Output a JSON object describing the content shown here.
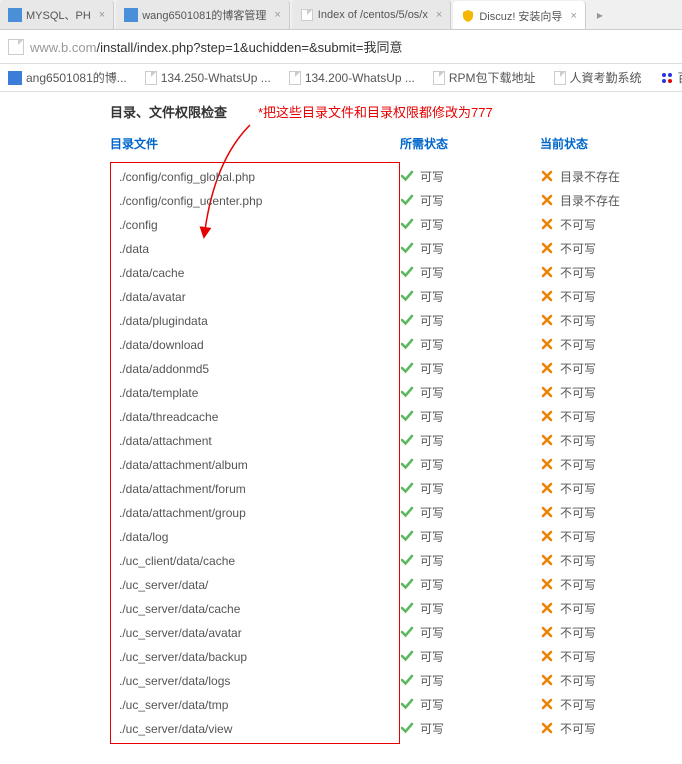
{
  "tabs": [
    {
      "label": "MYSQL、PH",
      "icon": "blue"
    },
    {
      "label": "wang6501081的博客管理",
      "icon": "blue"
    },
    {
      "label": "Index of /centos/5/os/x",
      "icon": "page"
    },
    {
      "label": "Discuz! 安装向导",
      "icon": "shield",
      "active": true
    }
  ],
  "url": {
    "host": "www.b.com",
    "path": "/install/index.php?step=1&uchidden=&submit=我同意"
  },
  "bookmarks": [
    {
      "label": "ang6501081的博..."
    },
    {
      "label": "134.250-WhatsUp ..."
    },
    {
      "label": "134.200-WhatsUp ..."
    },
    {
      "label": "RPM包下载地址"
    },
    {
      "label": "人資考勤系统"
    },
    {
      "label": "百度"
    }
  ],
  "section_title": "目录、文件权限检查",
  "hint": "*把这些目录文件和目录权限都修改为777",
  "headers": {
    "col1": "目录文件",
    "col2": "所需状态",
    "col3": "当前状态"
  },
  "ok_text": "可写",
  "fail_text": "不可写",
  "fail_text_notexist": "目录不存在",
  "rows": [
    {
      "path": "./config/config_global.php",
      "cur": "notexist"
    },
    {
      "path": "./config/config_ucenter.php",
      "cur": "notexist"
    },
    {
      "path": "./config",
      "cur": "fail"
    },
    {
      "path": "./data",
      "cur": "fail"
    },
    {
      "path": "./data/cache",
      "cur": "fail"
    },
    {
      "path": "./data/avatar",
      "cur": "fail"
    },
    {
      "path": "./data/plugindata",
      "cur": "fail"
    },
    {
      "path": "./data/download",
      "cur": "fail"
    },
    {
      "path": "./data/addonmd5",
      "cur": "fail"
    },
    {
      "path": "./data/template",
      "cur": "fail"
    },
    {
      "path": "./data/threadcache",
      "cur": "fail"
    },
    {
      "path": "./data/attachment",
      "cur": "fail"
    },
    {
      "path": "./data/attachment/album",
      "cur": "fail"
    },
    {
      "path": "./data/attachment/forum",
      "cur": "fail"
    },
    {
      "path": "./data/attachment/group",
      "cur": "fail"
    },
    {
      "path": "./data/log",
      "cur": "fail"
    },
    {
      "path": "./uc_client/data/cache",
      "cur": "fail"
    },
    {
      "path": "./uc_server/data/",
      "cur": "fail"
    },
    {
      "path": "./uc_server/data/cache",
      "cur": "fail"
    },
    {
      "path": "./uc_server/data/avatar",
      "cur": "fail"
    },
    {
      "path": "./uc_server/data/backup",
      "cur": "fail"
    },
    {
      "path": "./uc_server/data/logs",
      "cur": "fail"
    },
    {
      "path": "./uc_server/data/tmp",
      "cur": "fail"
    },
    {
      "path": "./uc_server/data/view",
      "cur": "fail"
    }
  ]
}
